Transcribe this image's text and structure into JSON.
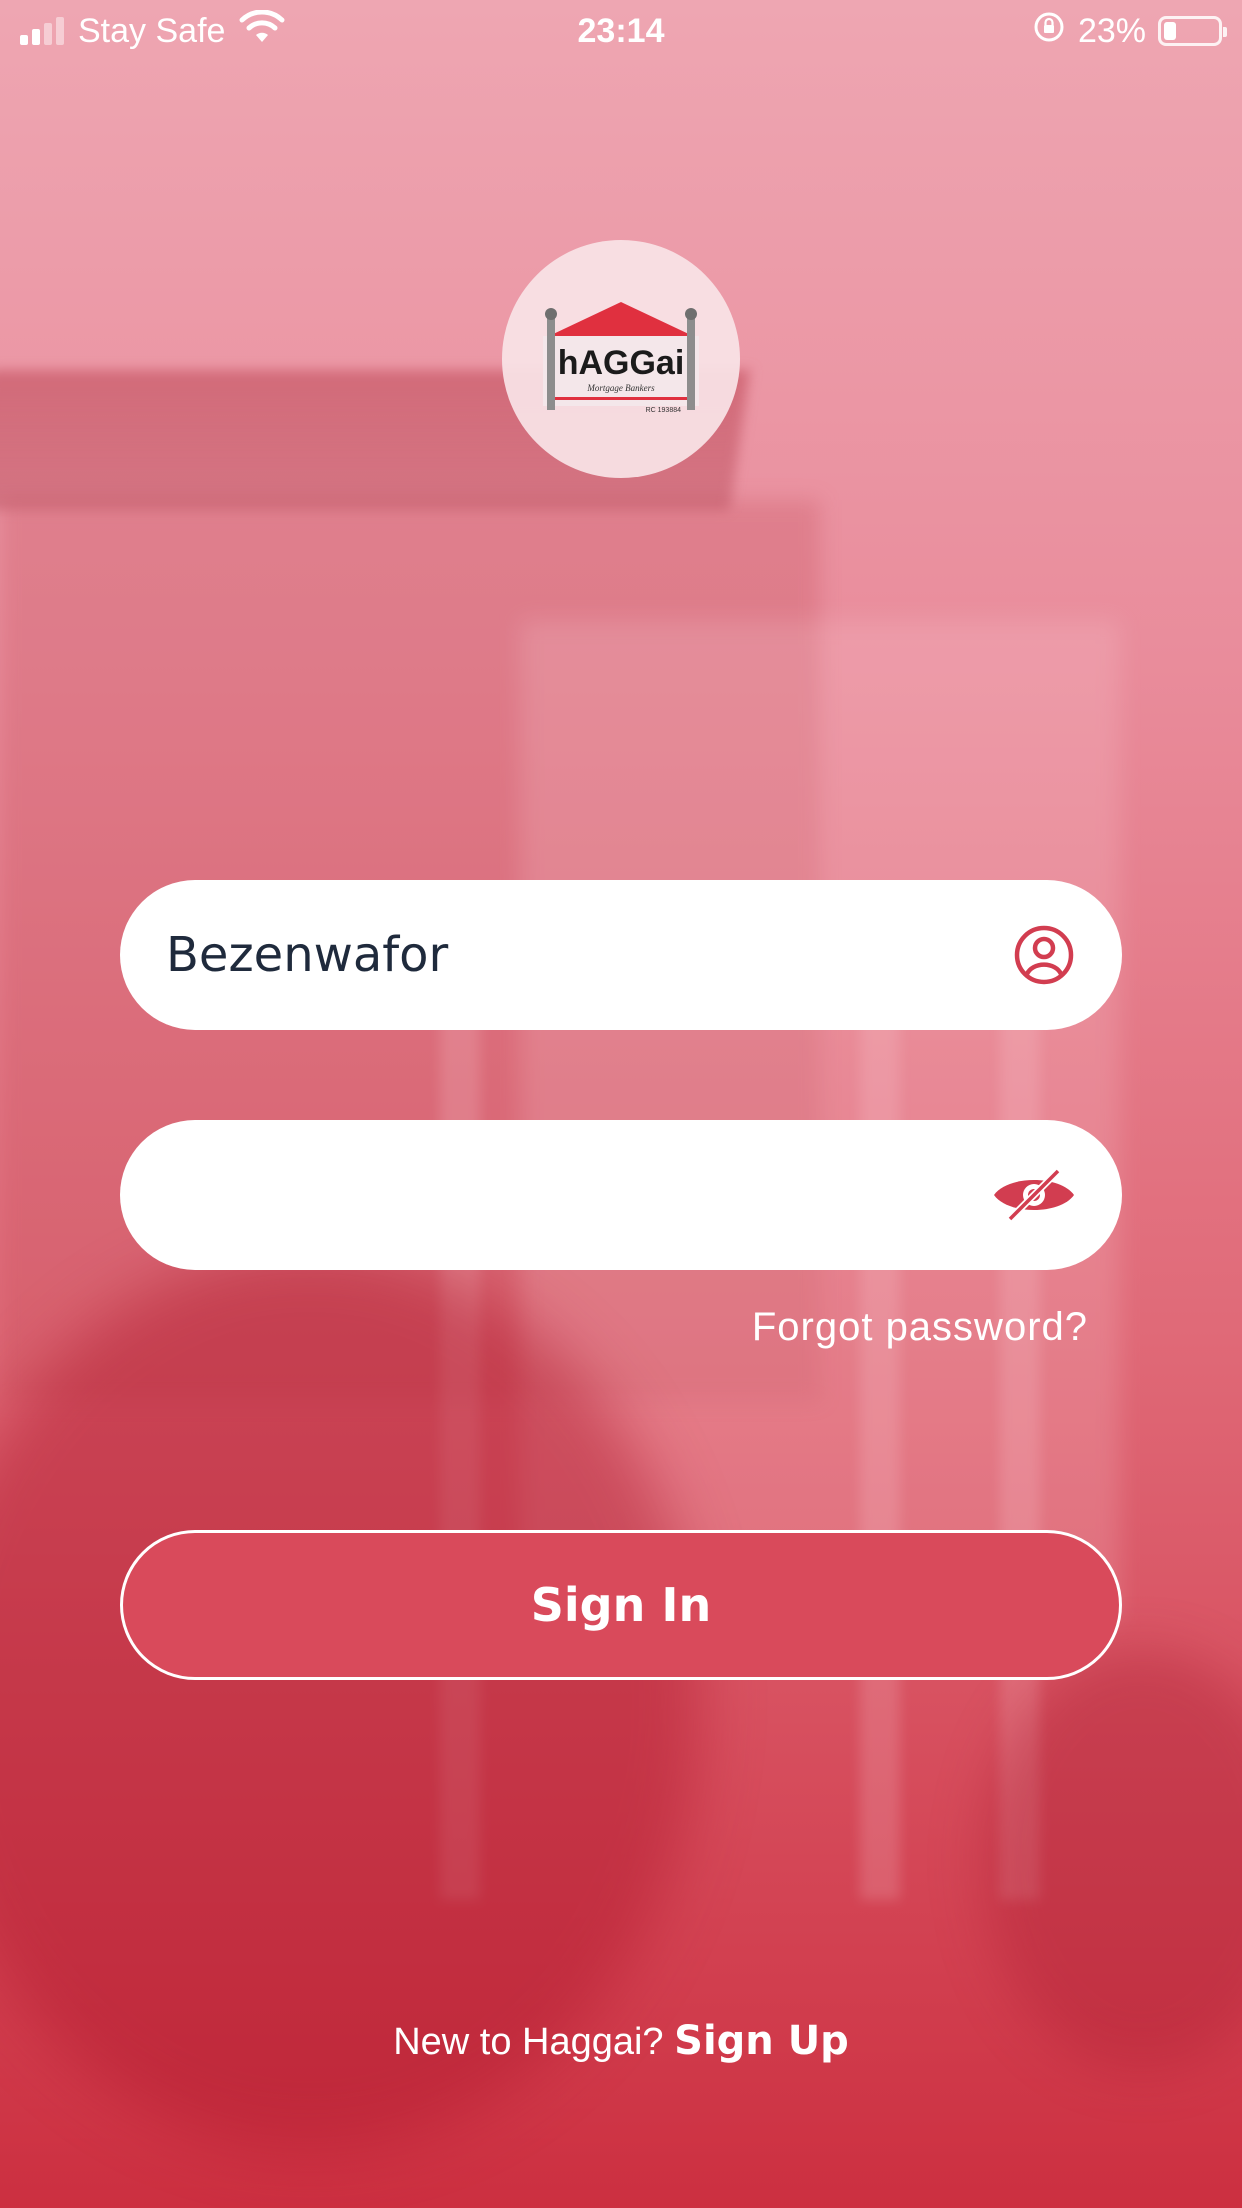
{
  "status_bar": {
    "carrier": "Stay Safe",
    "time": "23:14",
    "battery_percent": "23%",
    "battery_level": 0.23,
    "icons": [
      "signal-icon",
      "wifi-icon",
      "rotation-lock-icon",
      "battery-icon"
    ]
  },
  "logo": {
    "name": "HAGGAI logo",
    "brand_text": "hAGGai",
    "tagline": "Mortgage Bankers",
    "rc": "RC 193884"
  },
  "login": {
    "username_value": "Bezenwafor",
    "username_icon": "user-circle-icon",
    "password_value": "",
    "password_icon": "eye-slash-icon",
    "forgot_label": "Forgot password?",
    "signin_label": "Sign In"
  },
  "footer": {
    "prompt": "New to Haggai?",
    "signup_label": "Sign Up"
  },
  "colors": {
    "accent": "#d94a5b",
    "icon": "#d23d50",
    "text_dark": "#1f2a3c"
  }
}
